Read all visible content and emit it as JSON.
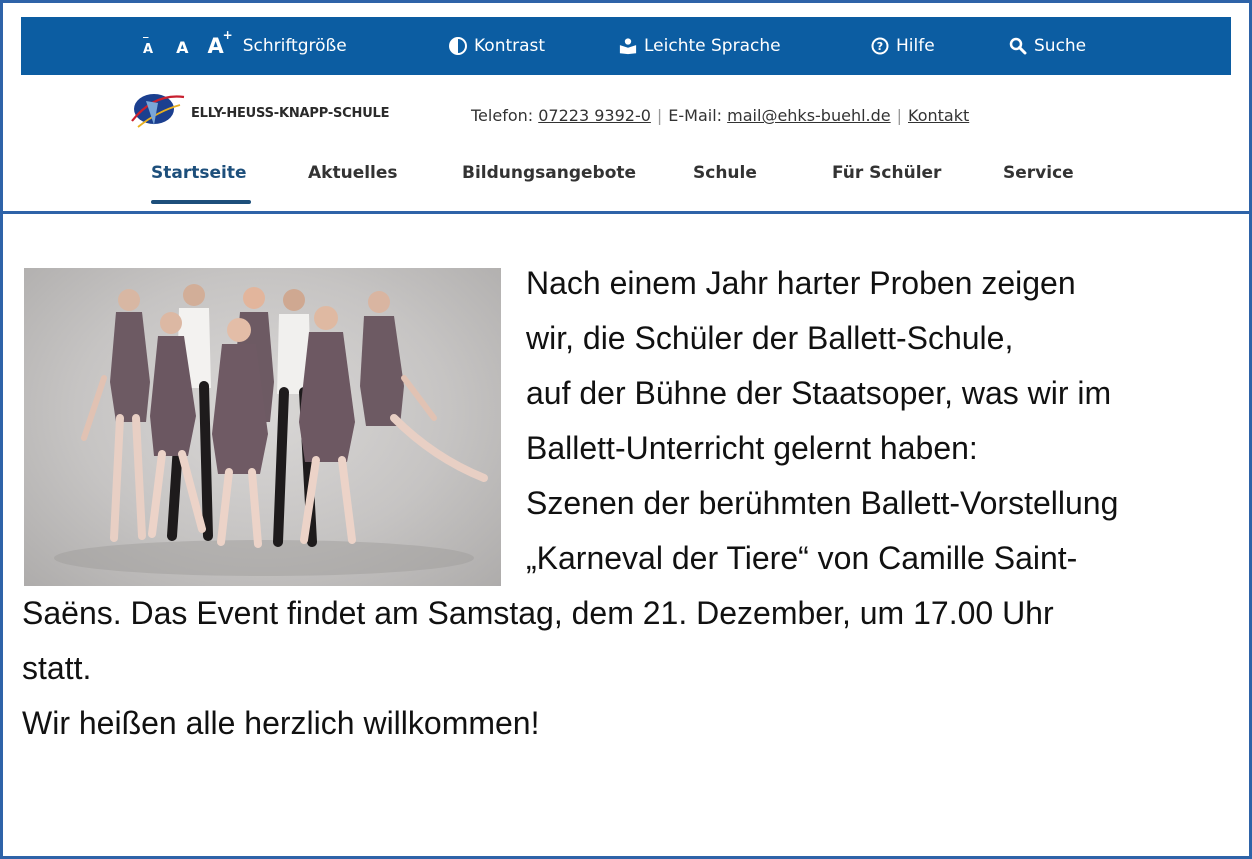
{
  "topbar": {
    "font_size_small": "A",
    "font_size_normal": "A",
    "font_size_large": "A",
    "font_size_label": "Schriftgröße",
    "contrast_label": "Kontrast",
    "easy_language_label": "Leichte Sprache",
    "help_label": "Hilfe",
    "search_label": "Suche",
    "background_color": "#0c5da2"
  },
  "header": {
    "logo_text": "ELLY-HEUSS-KNAPP-SCHULE",
    "phone_label": "Telefon:",
    "phone_number": "07223 9392-0",
    "email_label": "E-Mail:",
    "email_address": "mail@ehks-buehl.de",
    "contact_link": "Kontakt"
  },
  "nav": {
    "items": [
      {
        "label": "Startseite",
        "active": true
      },
      {
        "label": "Aktuelles",
        "active": false
      },
      {
        "label": "Bildungsangebote",
        "active": false
      },
      {
        "label": "Schule",
        "active": false
      },
      {
        "label": "Für Schüler",
        "active": false
      },
      {
        "label": "Service",
        "active": false
      }
    ],
    "active_color": "#1d4f7b"
  },
  "article": {
    "lines": [
      "Nach einem Jahr harter Proben zeigen",
      "wir, die Schüler der Ballett-Schule,",
      "auf der Bühne der Staatsoper, was wir im",
      "Ballett-Unterricht gelernt haben:",
      "Szenen der berühmten Ballett-Vorstellung",
      "„Karneval der Tiere“ von Camille Saint-",
      "Saëns. Das Event findet am Samstag, dem 21. Dezember, um 17.00 Uhr",
      "statt.",
      "Wir heißen alle herzlich willkommen!"
    ]
  },
  "frame_color": "#2e63a8"
}
